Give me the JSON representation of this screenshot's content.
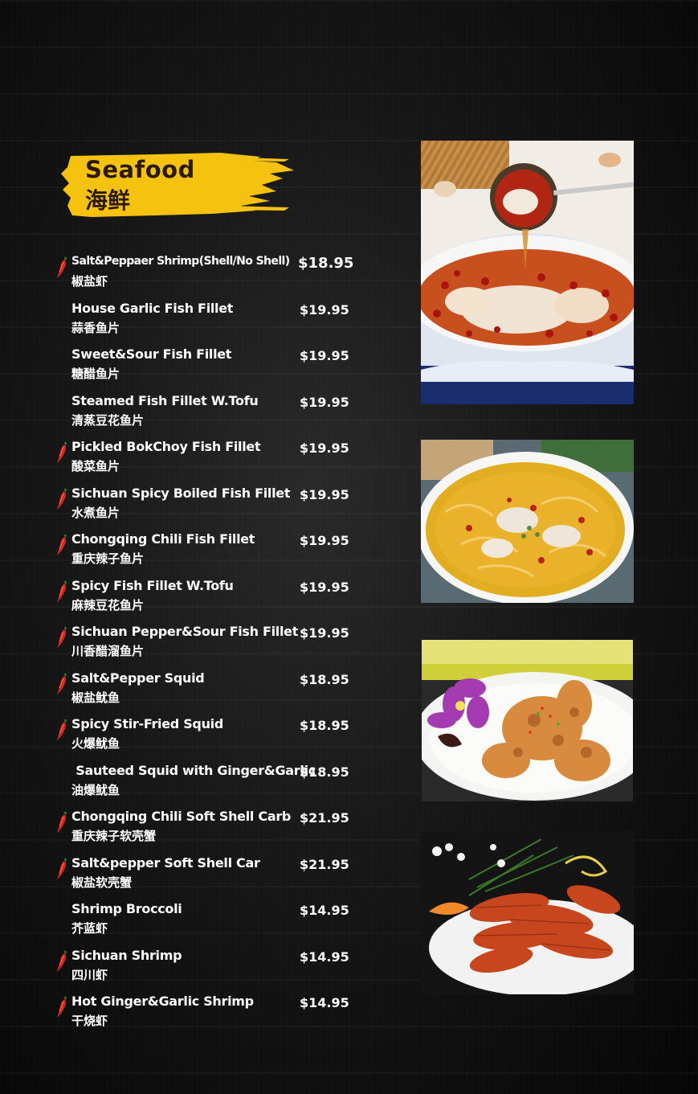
{
  "section": {
    "title_en": "Seafood",
    "title_zh": "海鲜"
  },
  "items": [
    {
      "name": "Salt&Peppaer Shrimp(Shell/No Shell)",
      "zh": "椒盐虾",
      "price": "$18.95",
      "spicy": true
    },
    {
      "name": "House Garlic Fish Fillet",
      "zh": "蒜香鱼片",
      "price": "$19.95",
      "spicy": false
    },
    {
      "name": "Sweet&Sour Fish Fillet",
      "zh": "糖醋鱼片",
      "price": "$19.95",
      "spicy": false
    },
    {
      "name": "Steamed Fish Fillet W.Tofu",
      "zh": "清蒸豆花鱼片",
      "price": "$19.95",
      "spicy": false
    },
    {
      "name": "Pickled BokChoy Fish Fillet",
      "zh": "酸菜鱼片",
      "price": "$19.95",
      "spicy": true
    },
    {
      "name": "Sichuan Spicy Boiled Fish Fillet",
      "zh": "水煮鱼片",
      "price": "$19.95",
      "spicy": true
    },
    {
      "name": "Chongqing Chili Fish Fillet",
      "zh": "重庆辣子鱼片",
      "price": "$19.95",
      "spicy": true
    },
    {
      "name": "Spicy Fish Fillet W.Tofu",
      "zh": "麻辣豆花鱼片",
      "price": "$19.95",
      "spicy": true
    },
    {
      "name": "Sichuan Pepper&Sour Fish Fillet",
      "zh": "川香醋溜鱼片",
      "price": "$19.95",
      "spicy": true
    },
    {
      "name": "Salt&Pepper Squid",
      "zh": "椒盐鱿鱼",
      "price": "$18.95",
      "spicy": true
    },
    {
      "name": "Spicy Stir-Fried Squid",
      "zh": "火爆鱿鱼",
      "price": "$18.95",
      "spicy": true
    },
    {
      "name": " Sauteed Squid with Ginger&Garlic",
      "zh": "油爆鱿鱼",
      "price": "$18.95",
      "spicy": false
    },
    {
      "name": "Chongqing Chili Soft Shell Carb",
      "zh": "重庆辣子软壳蟹",
      "price": "$21.95",
      "spicy": true
    },
    {
      "name": "Salt&pepper Soft Shell Car",
      "zh": "椒盐软壳蟹",
      "price": "$21.95",
      "spicy": true
    },
    {
      "name": "Shrimp Broccoli",
      "zh": "芥蓝虾",
      "price": "$14.95",
      "spicy": false
    },
    {
      "name": "Sichuan Shrimp",
      "zh": "四川虾",
      "price": "$14.95",
      "spicy": true
    },
    {
      "name": "Hot Ginger&Garlic Shrimp",
      "zh": "干烧虾",
      "price": "$14.95",
      "spicy": true
    }
  ],
  "photos": [
    {
      "icon": "boiled-fish-chili-ladle-photo"
    },
    {
      "icon": "pickled-cabbage-fish-bowl-photo"
    },
    {
      "icon": "salt-pepper-squid-plate-photo"
    },
    {
      "icon": "dry-fried-shrimp-plate-photo"
    }
  ],
  "colors": {
    "banner": "#f5c20f",
    "title_text": "#2a1a05",
    "chili": "#d7261e",
    "text": "#ffffff",
    "background": "#141414"
  }
}
